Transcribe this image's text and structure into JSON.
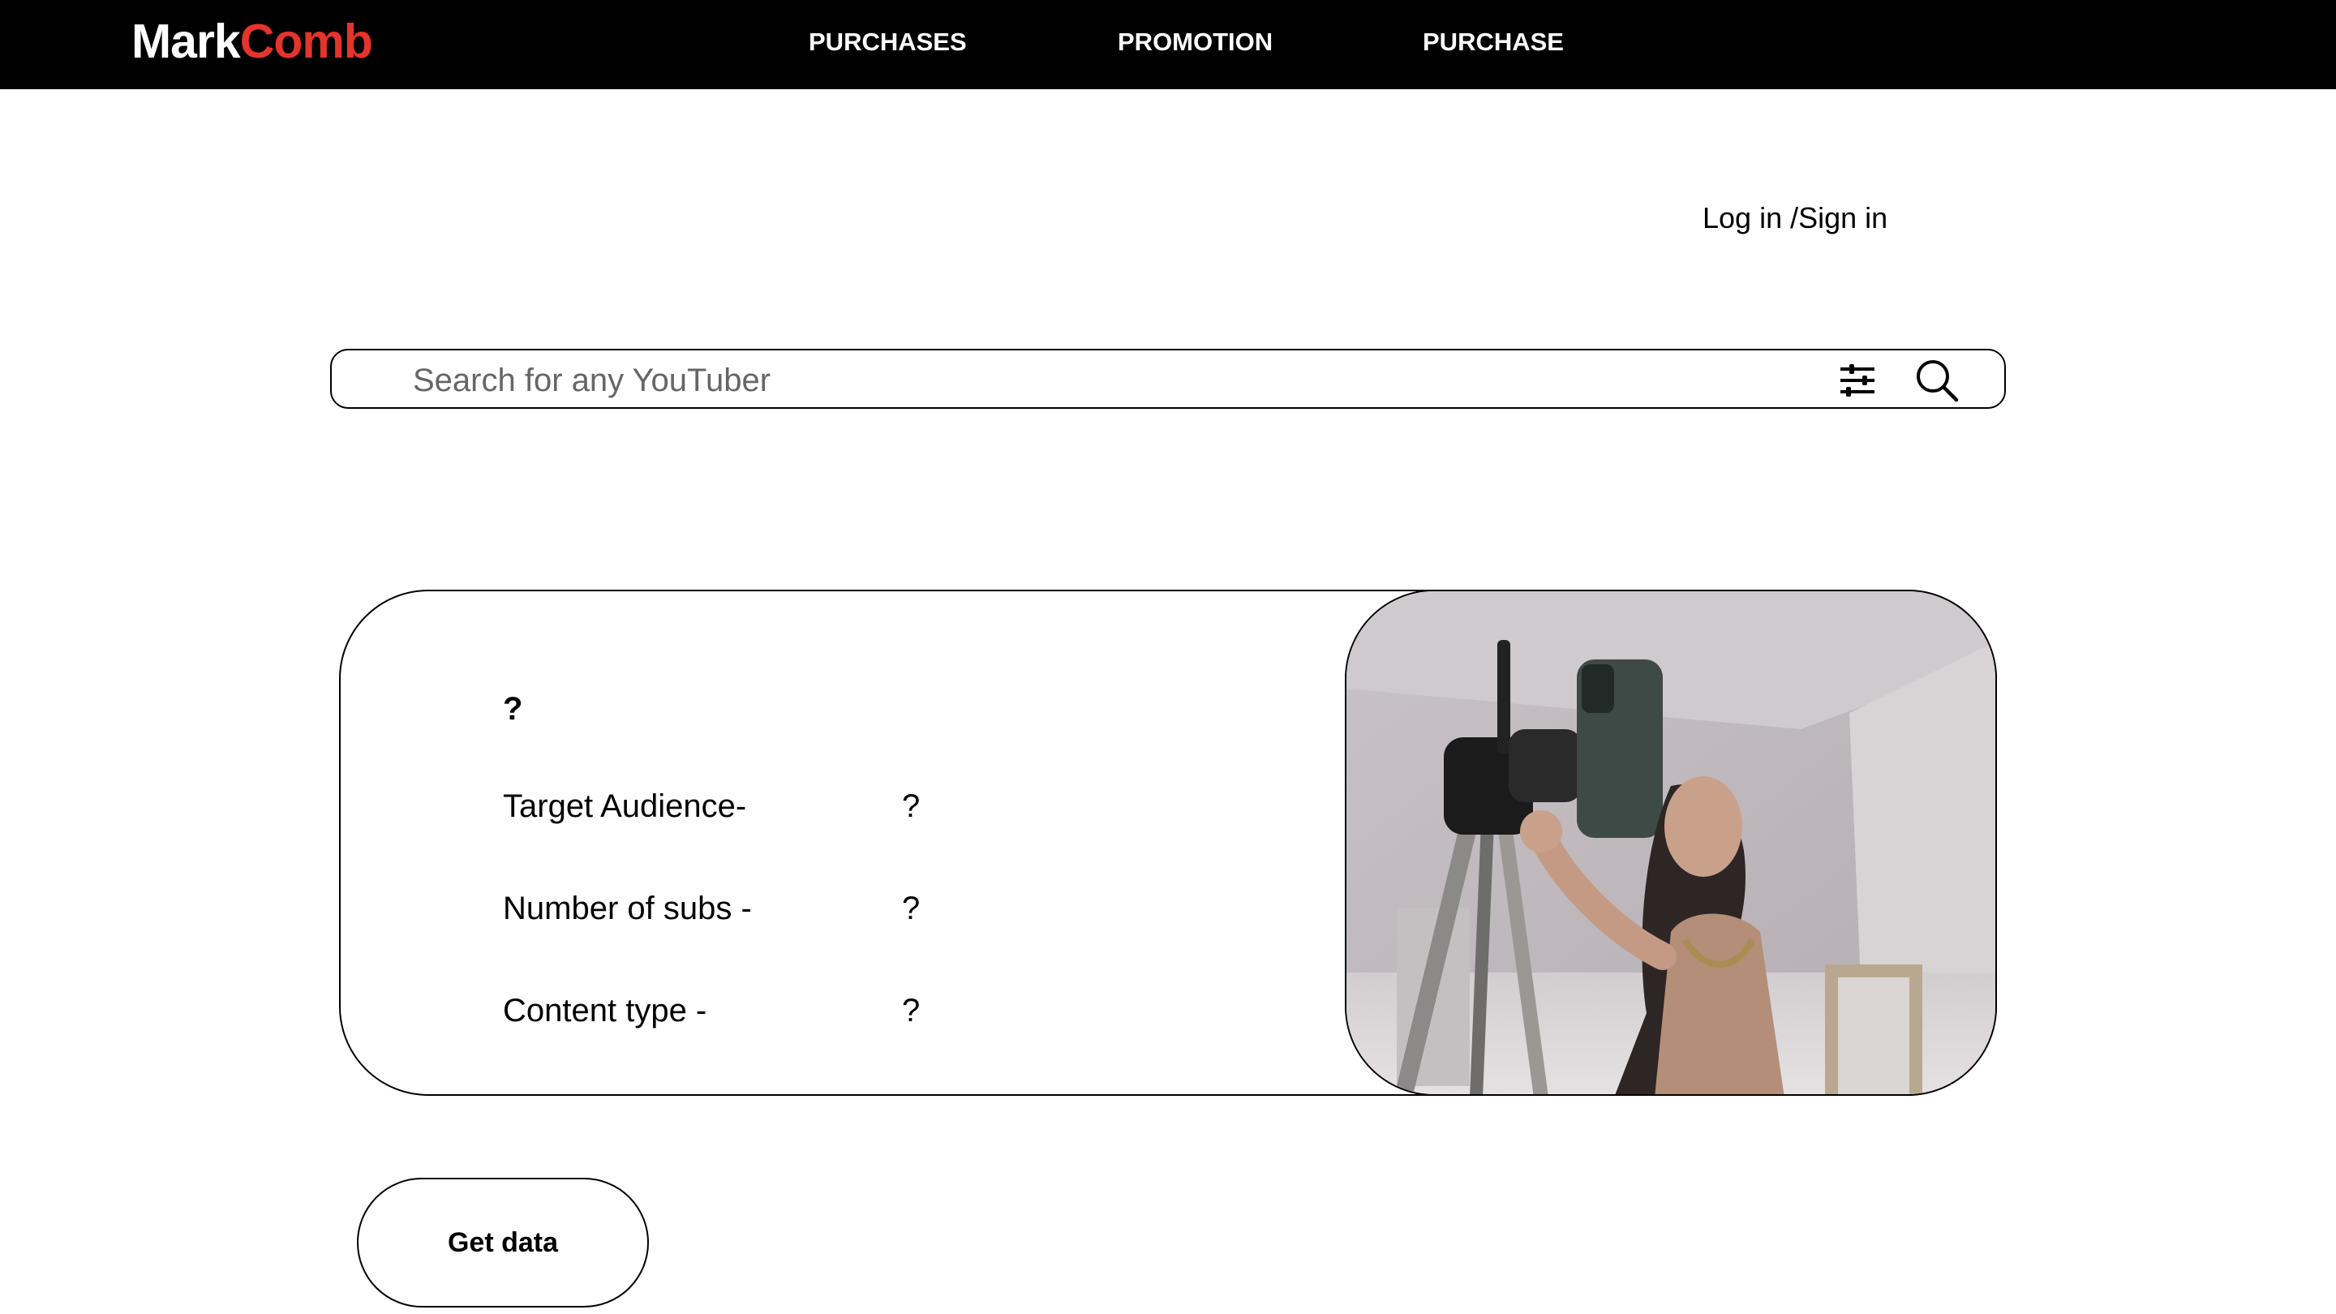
{
  "brand": {
    "part1": "Mark",
    "part2": "Comb",
    "accent_color": "#e3352b"
  },
  "nav": {
    "items": [
      {
        "label": "PURCHASES"
      },
      {
        "label": "PROMOTION"
      },
      {
        "label": "PURCHASE"
      }
    ]
  },
  "auth": {
    "label": "Log in /Sign in"
  },
  "search": {
    "placeholder": "Search for any YouTuber",
    "value": "",
    "filter_icon": "sliders-icon",
    "search_icon": "magnifier-icon"
  },
  "card": {
    "title": "?",
    "rows": [
      {
        "label": "Target Audience-",
        "value": "?"
      },
      {
        "label": "Number of subs -",
        "value": "?"
      },
      {
        "label": "Content type -",
        "value": "?"
      }
    ],
    "image": "photo of a woman adjusting a smartphone on a tripod"
  },
  "actions": {
    "get_data_label": "Get data"
  }
}
